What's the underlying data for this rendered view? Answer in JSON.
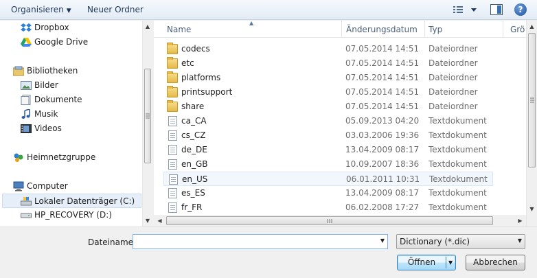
{
  "toolbar": {
    "organize_label": "Organisieren",
    "new_folder_label": "Neuer Ordner",
    "help_label": "?"
  },
  "nav": {
    "items": [
      {
        "label": "Dropbox",
        "icon": "dropbox-icon"
      },
      {
        "label": "Google Drive",
        "icon": "google-drive-icon"
      },
      {
        "label": "Bibliotheken",
        "icon": "libraries-icon"
      },
      {
        "label": "Bilder",
        "icon": "pictures-icon"
      },
      {
        "label": "Dokumente",
        "icon": "documents-icon"
      },
      {
        "label": "Musik",
        "icon": "music-icon"
      },
      {
        "label": "Videos",
        "icon": "videos-icon"
      },
      {
        "label": "Heimnetzgruppe",
        "icon": "homegroup-icon"
      },
      {
        "label": "Computer",
        "icon": "computer-icon"
      },
      {
        "label": "Lokaler Datenträger (C:)",
        "icon": "local-disk-icon",
        "selected": true
      },
      {
        "label": "HP_RECOVERY (D:)",
        "icon": "drive-icon"
      }
    ]
  },
  "file_list": {
    "columns": [
      "Name",
      "Änderungsdatum",
      "Typ",
      "Grö"
    ],
    "rows": [
      {
        "name": "codecs",
        "date": "07.05.2014 14:51",
        "type": "Dateiordner",
        "kind": "folder"
      },
      {
        "name": "etc",
        "date": "07.05.2014 14:51",
        "type": "Dateiordner",
        "kind": "folder"
      },
      {
        "name": "platforms",
        "date": "07.05.2014 14:51",
        "type": "Dateiordner",
        "kind": "folder"
      },
      {
        "name": "printsupport",
        "date": "07.05.2014 14:51",
        "type": "Dateiordner",
        "kind": "folder"
      },
      {
        "name": "share",
        "date": "07.05.2014 14:51",
        "type": "Dateiordner",
        "kind": "folder"
      },
      {
        "name": "ca_CA",
        "date": "05.09.2013 04:20",
        "type": "Textdokument",
        "kind": "text"
      },
      {
        "name": "cs_CZ",
        "date": "03.03.2006 19:36",
        "type": "Textdokument",
        "kind": "text"
      },
      {
        "name": "de_DE",
        "date": "13.04.2009 08:17",
        "type": "Textdokument",
        "kind": "text"
      },
      {
        "name": "en_GB",
        "date": "10.09.2007 18:36",
        "type": "Textdokument",
        "kind": "text"
      },
      {
        "name": "en_US",
        "date": "06.01.2011 10:31",
        "type": "Textdokument",
        "kind": "text",
        "hover": true
      },
      {
        "name": "es_ES",
        "date": "13.04.2009 08:17",
        "type": "Textdokument",
        "kind": "text"
      },
      {
        "name": "fr_FR",
        "date": "06.02.2008 17:27",
        "type": "Textdokument",
        "kind": "text"
      }
    ]
  },
  "form": {
    "filename_label": "Dateiname:",
    "filename_value": "",
    "filter_value": "Dictionary (*.dic)",
    "open_label": "Öffnen",
    "cancel_label": "Abbrechen"
  },
  "colors": {
    "toolbar_text": "#1e395b",
    "selection_bg": "#e5eef9",
    "header_text": "#4c607a",
    "meta_text": "#6d6d6d",
    "focus_border": "#7eb4ea"
  }
}
